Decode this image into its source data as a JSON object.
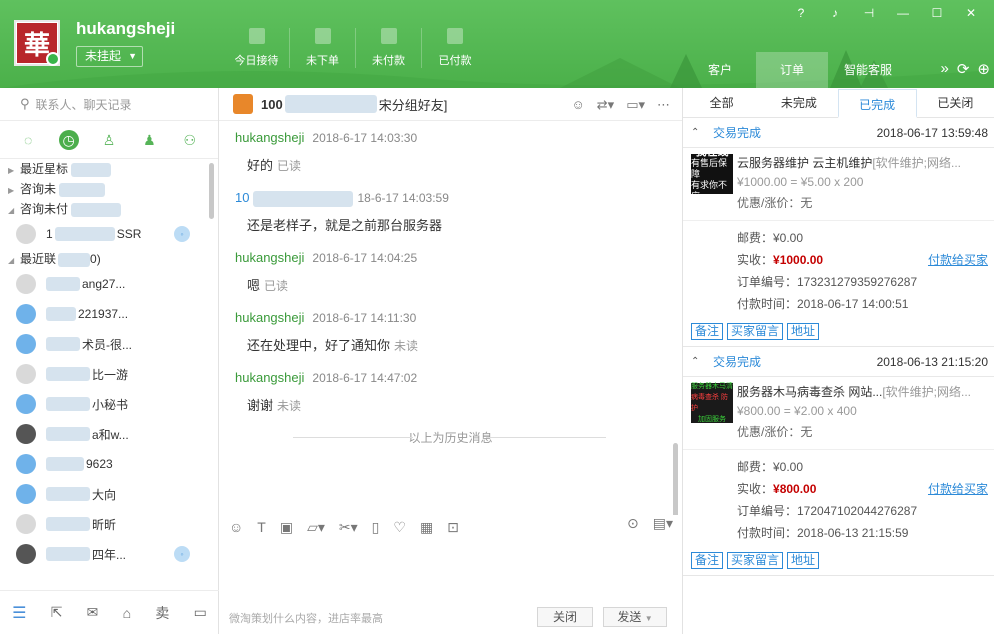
{
  "header": {
    "username": "hukangsheji",
    "status": "未挂起",
    "avatar_char": "華",
    "stats": [
      {
        "label": "今日接待"
      },
      {
        "label": "未下单"
      },
      {
        "label": "未付款"
      },
      {
        "label": "已付款"
      }
    ],
    "tabs": [
      {
        "label": "客户"
      },
      {
        "label": "订单"
      },
      {
        "label": "智能客服"
      }
    ],
    "accent": "#4cae4c"
  },
  "left": {
    "search_placeholder": "联系人、聊天记录",
    "groups": [
      {
        "label": "最近星标"
      },
      {
        "label": "咨询未"
      },
      {
        "label": "咨询未付"
      }
    ],
    "contacts": [
      {
        "label": "1",
        "suffix": "SSR"
      },
      {
        "group": "最近联",
        "count": "0)"
      },
      {
        "label": "ang27..."
      },
      {
        "label": "221937..."
      },
      {
        "label": "术员-很..."
      },
      {
        "label": "比一游"
      },
      {
        "label": "小秘书"
      },
      {
        "label": "a和w..."
      },
      {
        "label": "9623"
      },
      {
        "label": "大向"
      },
      {
        "label": "昕昕"
      },
      {
        "label": "四年..."
      }
    ]
  },
  "chat": {
    "title_prefix": "100",
    "title_suffix": "宋分组好友]",
    "messages": [
      {
        "sender": "hukangsheji",
        "time": "2018-6-17 14:03:30",
        "text": "好的",
        "read": "已读"
      },
      {
        "sender": "10",
        "time": "18-6-17 14:03:59",
        "text": "还是老样子，就是之前那台服务器",
        "read": ""
      },
      {
        "sender": "hukangsheji",
        "time": "2018-6-17 14:04:25",
        "text": "嗯",
        "read": "已读"
      },
      {
        "sender": "hukangsheji",
        "time": "2018-6-17 14:11:30",
        "text": "还在处理中，好了通知你",
        "read": "未读"
      },
      {
        "sender": "hukangsheji",
        "time": "2018-6-17 14:47:02",
        "text": "谢谢",
        "read": "未读"
      }
    ],
    "history_label": "以上为历史消息",
    "hint": "微淘策划什么内容，进店率最高",
    "close_label": "关闭",
    "send_label": "发送"
  },
  "orders": {
    "tabs": [
      "全部",
      "未完成",
      "已完成",
      "已关闭"
    ],
    "active_tab": 2,
    "list": [
      {
        "status": "交易完成",
        "date": "2018-06-17 13:59:48",
        "title": "云服务器维护 云主机维护",
        "tags": "[软件维护;网络...",
        "price": "¥1000.00 = ¥5.00 x 200",
        "discount": "优惠/涨价：无",
        "postage": "邮费：¥0.00",
        "received_label": "实收：",
        "received": "¥1000.00",
        "order_no": "订单编号：173231279359276287",
        "pay_time": "付款时间：2018-06-17 14:00:51",
        "pay_link": "付款给买家",
        "thumb_line1": "我在线",
        "thumb_line2": "有售后保障",
        "thumb_line3": "有求你不应"
      },
      {
        "status": "交易完成",
        "date": "2018-06-13 21:15:20",
        "title": "服务器木马病毒查杀 网站...",
        "tags": "[软件维护;网络...",
        "price": "¥800.00 = ¥2.00 x 400",
        "discount": "优惠/涨价：无",
        "postage": "邮费：¥0.00",
        "received_label": "实收：",
        "received": "¥800.00",
        "order_no": "订单编号：172047102044276287",
        "pay_time": "付款时间：2018-06-13 21:15:59",
        "pay_link": "付款给买家",
        "thumb_line1": "服务器木马清",
        "thumb_line2": "病毒查杀 防护",
        "thumb_line3": "加固服务"
      }
    ],
    "actions": [
      "备注",
      "买家留言",
      "地址"
    ]
  }
}
